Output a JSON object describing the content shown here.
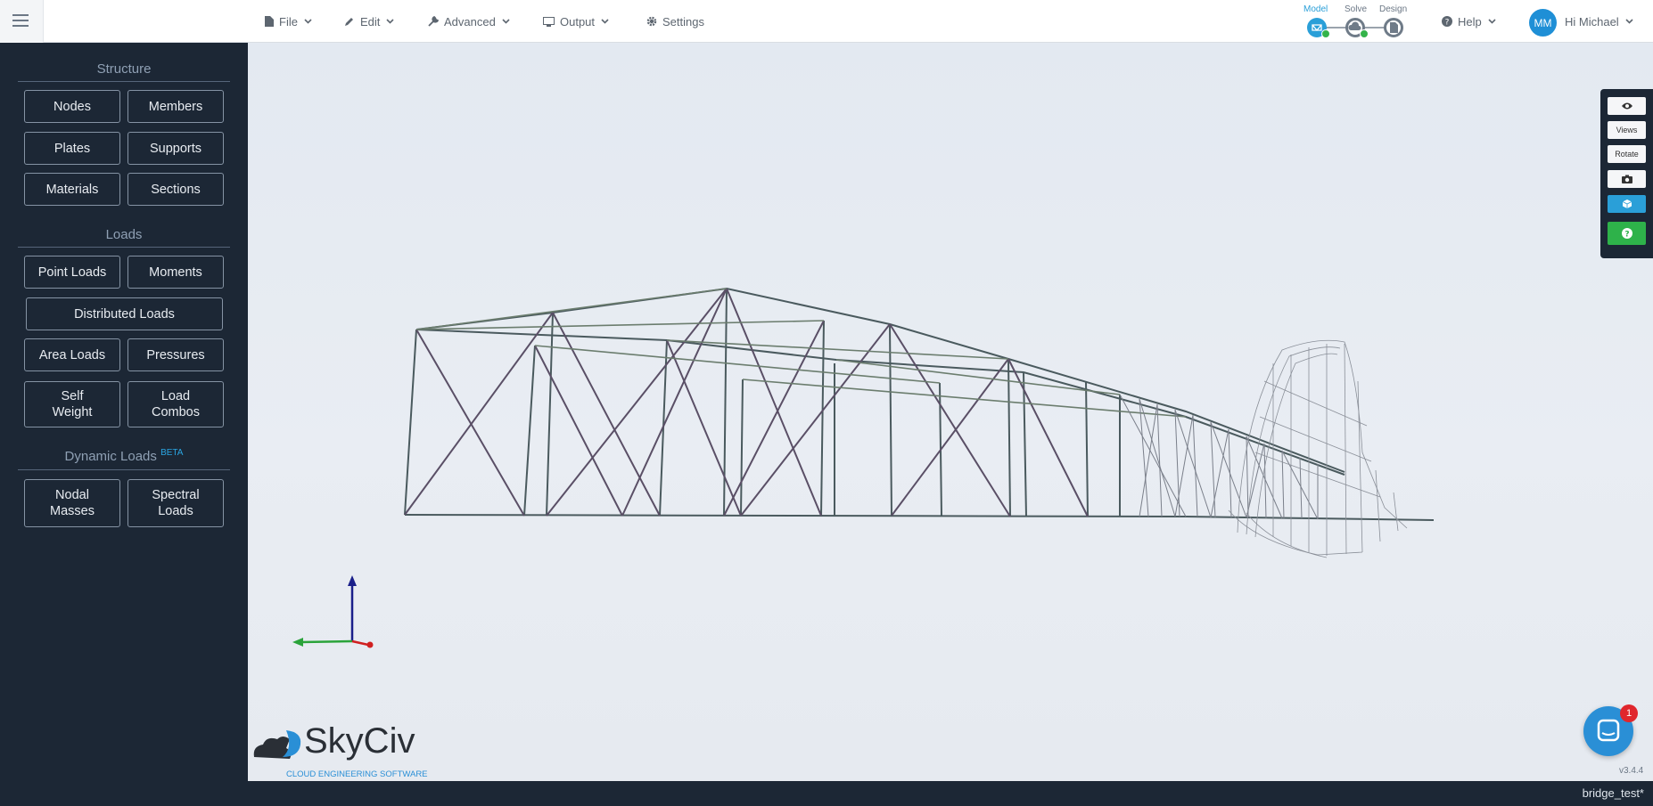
{
  "header": {
    "menus": [
      {
        "label": "File",
        "icon": "file-icon"
      },
      {
        "label": "Edit",
        "icon": "pencil-icon"
      },
      {
        "label": "Advanced",
        "icon": "wrench-icon"
      },
      {
        "label": "Output",
        "icon": "monitor-icon"
      },
      {
        "label": "Settings",
        "icon": "gear-icon"
      }
    ],
    "workflow": [
      {
        "label": "Model",
        "active": true
      },
      {
        "label": "Solve",
        "active": false
      },
      {
        "label": "Design",
        "active": false
      }
    ],
    "help_label": "Help",
    "user": {
      "initials": "MM",
      "greeting": "Hi Michael"
    }
  },
  "sidebar": {
    "structure": {
      "title": "Structure",
      "buttons": [
        "Nodes",
        "Members",
        "Plates",
        "Supports",
        "Materials",
        "Sections"
      ]
    },
    "loads": {
      "title": "Loads",
      "buttons": [
        "Point Loads",
        "Moments",
        "Distributed Loads",
        "Area Loads",
        "Pressures",
        "Self Weight",
        "Load Combos"
      ]
    },
    "dynamic": {
      "title": "Dynamic Loads",
      "badge": "BETA",
      "buttons": [
        "Nodal Masses",
        "Spectral Loads"
      ]
    }
  },
  "toolbar": {
    "views_label": "Views",
    "rotate_label": "Rotate",
    "icons": [
      "eye-icon",
      "camera-icon",
      "cube-icon",
      "question-icon"
    ]
  },
  "logo": {
    "name": "SkyCiv",
    "tagline": "CLOUD ENGINEERING SOFTWARE"
  },
  "version": "v3.4.4",
  "filename": "bridge_test*",
  "chat": {
    "unread": "1"
  },
  "colors": {
    "sidebar_bg": "#1c2735",
    "accent_blue": "#2a9fd8",
    "success_green": "#2eb24a",
    "badge_red": "#e0262d"
  }
}
